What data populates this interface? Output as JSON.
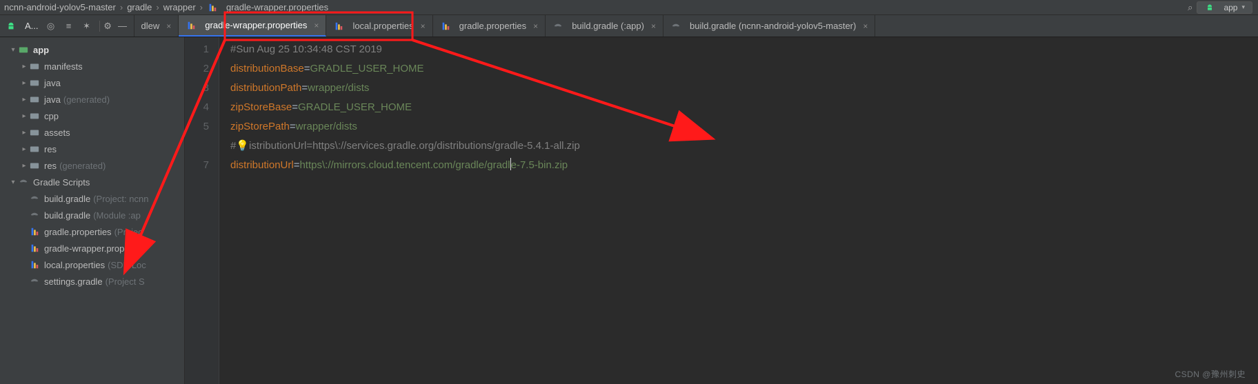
{
  "breadcrumb": {
    "root": "ncnn-android-yolov5-master",
    "p1": "gradle",
    "p2": "wrapper",
    "file": "gradle-wrapper.properties"
  },
  "run": {
    "label": "app"
  },
  "toolbar": {
    "project_label": "A..."
  },
  "tabOverflow": {
    "label": "dlew"
  },
  "tabs": [
    {
      "label": "gradle-wrapper.properties",
      "kind": "prop",
      "active": true
    },
    {
      "label": "local.properties",
      "kind": "prop"
    },
    {
      "label": "gradle.properties",
      "kind": "prop"
    },
    {
      "label": "build.gradle (:app)",
      "kind": "gradle"
    },
    {
      "label": "build.gradle (ncnn-android-yolov5-master)",
      "kind": "gradle"
    }
  ],
  "tree": {
    "app": "app",
    "manifests": "manifests",
    "java": "java",
    "java_gen": "java",
    "java_gen_note": "(generated)",
    "cpp": "cpp",
    "assets": "assets",
    "res": "res",
    "res_gen": "res",
    "res_gen_note": "(generated)",
    "gradle_scripts": "Gradle Scripts",
    "bg_project": "build.gradle",
    "bg_project_note": "(Project: ncnn",
    "bg_module": "build.gradle",
    "bg_module_note": "(Module :ap",
    "g_props": "gradle.properties",
    "g_props_note": "(Projec",
    "g_wrap": "gradle-wrapper.propertie",
    "local": "local.properties",
    "local_note": "(SDK Loc",
    "settings": "settings.gradle",
    "settings_note": "(Project S"
  },
  "gutter": {
    "l1": "1",
    "l2": "2",
    "l3": "3",
    "l4": "4",
    "l5": "5",
    "l6": "",
    "l7": "7"
  },
  "code": {
    "c1": "#Sun Aug 25 10:34:48 CST 2019",
    "k2": "distributionBase",
    "v2": "GRADLE_USER_HOME",
    "k3": "distributionPath",
    "v3": "wrapper/dists",
    "k4": "zipStoreBase",
    "v4": "GRADLE_USER_HOME",
    "k5": "zipStorePath",
    "v5": "wrapper/dists",
    "c6a": "#",
    "c6b": "istributionUrl=https\\://services.gradle.org/distributions/gradle-5.4.1-all.zip",
    "k7": "distributionUrl",
    "v7a": "https\\://mirrors.cloud.tencent.com/gradle/gradl",
    "v7b": "e-7.5-bin.zip"
  },
  "watermark": "CSDN @豫州刺史"
}
